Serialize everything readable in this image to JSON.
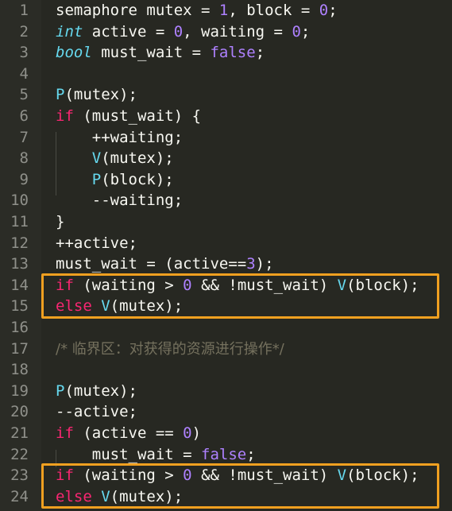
{
  "colors": {
    "background": "#272822",
    "line_number": "#8f908a",
    "plain": "#f8f8f2",
    "keyword": "#f92672",
    "number": "#ae81ff",
    "type": "#66d9ef",
    "function": "#66d9ef",
    "comment": "#75715e",
    "highlight_box": "#f0a020"
  },
  "editor": {
    "highlight_ranges": [
      [
        14,
        15
      ],
      [
        23,
        24
      ]
    ],
    "lines": [
      {
        "number": "1",
        "tokens": [
          {
            "text": "semaphore mutex = ",
            "type": "plain"
          },
          {
            "text": "1",
            "type": "number"
          },
          {
            "text": ", block = ",
            "type": "plain"
          },
          {
            "text": "0",
            "type": "number"
          },
          {
            "text": ";",
            "type": "plain"
          }
        ]
      },
      {
        "number": "2",
        "tokens": [
          {
            "text": "int",
            "type": "type"
          },
          {
            "text": " active = ",
            "type": "plain"
          },
          {
            "text": "0",
            "type": "number"
          },
          {
            "text": ", waiting = ",
            "type": "plain"
          },
          {
            "text": "0",
            "type": "number"
          },
          {
            "text": ";",
            "type": "plain"
          }
        ]
      },
      {
        "number": "3",
        "tokens": [
          {
            "text": "bool",
            "type": "type"
          },
          {
            "text": " must_wait = ",
            "type": "plain"
          },
          {
            "text": "false",
            "type": "number"
          },
          {
            "text": ";",
            "type": "plain"
          }
        ]
      },
      {
        "number": "4",
        "tokens": []
      },
      {
        "number": "5",
        "tokens": [
          {
            "text": "P",
            "type": "func"
          },
          {
            "text": "(mutex);",
            "type": "plain"
          }
        ]
      },
      {
        "number": "6",
        "tokens": [
          {
            "text": "if",
            "type": "keyword"
          },
          {
            "text": " (must_wait) {",
            "type": "plain"
          }
        ]
      },
      {
        "number": "7",
        "tokens": [
          {
            "text": "    ++waiting;",
            "type": "plain"
          }
        ]
      },
      {
        "number": "8",
        "tokens": [
          {
            "text": "    ",
            "type": "plain"
          },
          {
            "text": "V",
            "type": "func"
          },
          {
            "text": "(mutex);",
            "type": "plain"
          }
        ]
      },
      {
        "number": "9",
        "tokens": [
          {
            "text": "    ",
            "type": "plain"
          },
          {
            "text": "P",
            "type": "func"
          },
          {
            "text": "(block);",
            "type": "plain"
          }
        ]
      },
      {
        "number": "10",
        "tokens": [
          {
            "text": "    --waiting;",
            "type": "plain"
          }
        ]
      },
      {
        "number": "11",
        "tokens": [
          {
            "text": "}",
            "type": "plain"
          }
        ]
      },
      {
        "number": "12",
        "tokens": [
          {
            "text": "++active;",
            "type": "plain"
          }
        ]
      },
      {
        "number": "13",
        "tokens": [
          {
            "text": "must_wait = (active==",
            "type": "plain"
          },
          {
            "text": "3",
            "type": "number"
          },
          {
            "text": ");",
            "type": "plain"
          }
        ]
      },
      {
        "number": "14",
        "tokens": [
          {
            "text": "if",
            "type": "keyword"
          },
          {
            "text": " (waiting > ",
            "type": "plain"
          },
          {
            "text": "0",
            "type": "number"
          },
          {
            "text": " && !must_wait) ",
            "type": "plain"
          },
          {
            "text": "V",
            "type": "func"
          },
          {
            "text": "(block);",
            "type": "plain"
          }
        ]
      },
      {
        "number": "15",
        "tokens": [
          {
            "text": "else",
            "type": "keyword"
          },
          {
            "text": " ",
            "type": "plain"
          },
          {
            "text": "V",
            "type": "func"
          },
          {
            "text": "(mutex);",
            "type": "plain"
          }
        ]
      },
      {
        "number": "16",
        "tokens": []
      },
      {
        "number": "17",
        "tokens": [
          {
            "text": "/* 临界区：对获得的资源进行操作*/",
            "type": "comment"
          }
        ]
      },
      {
        "number": "18",
        "tokens": []
      },
      {
        "number": "19",
        "tokens": [
          {
            "text": "P",
            "type": "func"
          },
          {
            "text": "(mutex);",
            "type": "plain"
          }
        ]
      },
      {
        "number": "20",
        "tokens": [
          {
            "text": "--active;",
            "type": "plain"
          }
        ]
      },
      {
        "number": "21",
        "tokens": [
          {
            "text": "if",
            "type": "keyword"
          },
          {
            "text": " (active == ",
            "type": "plain"
          },
          {
            "text": "0",
            "type": "number"
          },
          {
            "text": ")",
            "type": "plain"
          }
        ]
      },
      {
        "number": "22",
        "tokens": [
          {
            "text": "    must_wait = ",
            "type": "plain"
          },
          {
            "text": "false",
            "type": "number"
          },
          {
            "text": ";",
            "type": "plain"
          }
        ]
      },
      {
        "number": "23",
        "tokens": [
          {
            "text": "if",
            "type": "keyword"
          },
          {
            "text": " (waiting > ",
            "type": "plain"
          },
          {
            "text": "0",
            "type": "number"
          },
          {
            "text": " && !must_wait) ",
            "type": "plain"
          },
          {
            "text": "V",
            "type": "func"
          },
          {
            "text": "(block);",
            "type": "plain"
          }
        ]
      },
      {
        "number": "24",
        "tokens": [
          {
            "text": "else",
            "type": "keyword"
          },
          {
            "text": " ",
            "type": "plain"
          },
          {
            "text": "V",
            "type": "func"
          },
          {
            "text": "(mutex);",
            "type": "plain"
          }
        ]
      }
    ]
  }
}
